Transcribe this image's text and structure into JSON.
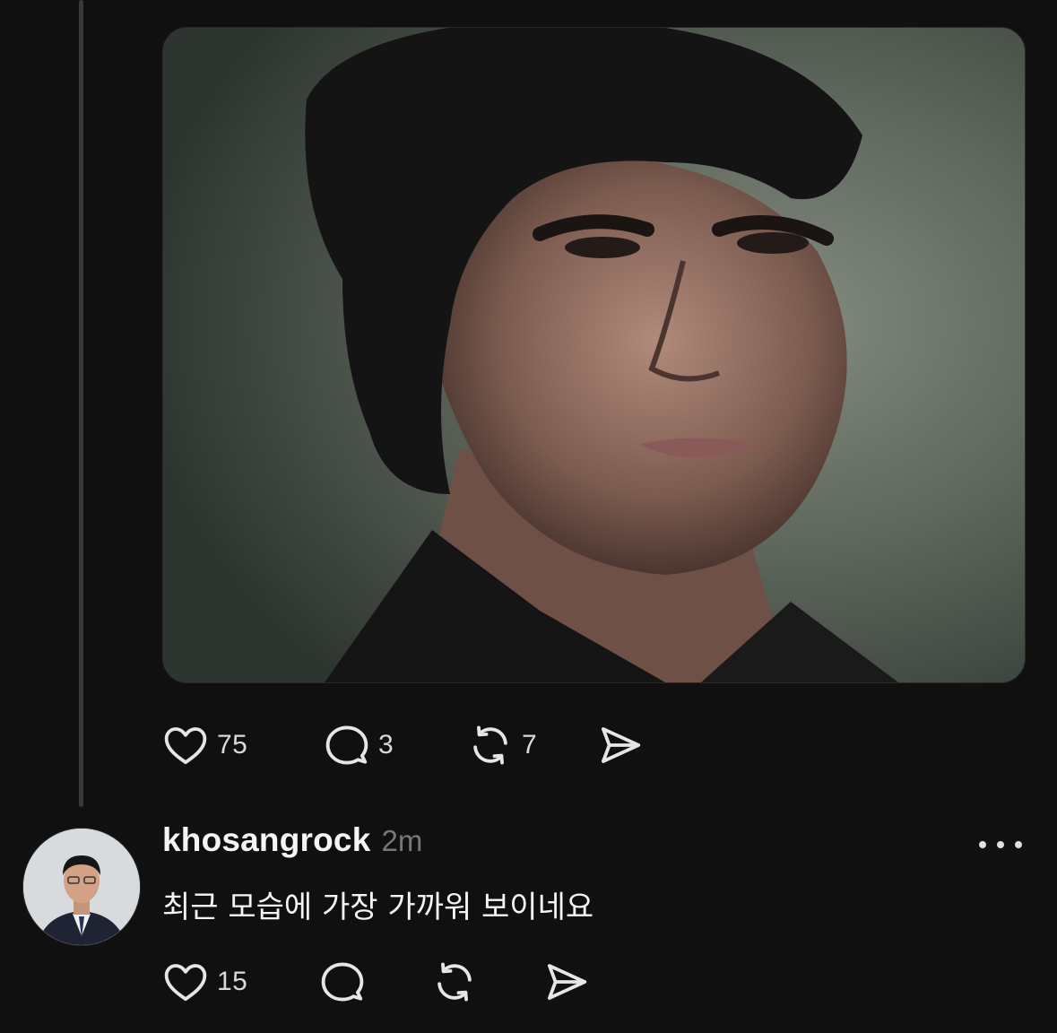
{
  "post": {
    "media": {
      "description_icon": "photo"
    },
    "actions": {
      "likes": "75",
      "replies": "3",
      "reposts": "7"
    }
  },
  "reply": {
    "username": "khosangrock",
    "timestamp": "2m",
    "text": "최근 모습에 가장 가까워 보이네요",
    "actions": {
      "likes": "15"
    }
  },
  "colors": {
    "background": "#101010",
    "text_primary": "#f3f5f7",
    "text_secondary": "#777777",
    "thread_line": "#3a3a3a"
  }
}
